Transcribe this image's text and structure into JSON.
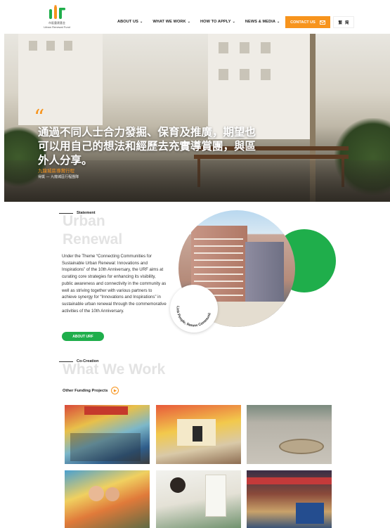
{
  "header": {
    "logo_cn": "市區重建基金",
    "logo_en": "Urban Renewal Fund",
    "nav": [
      "ABOUT US",
      "WHAT WE WORK",
      "HOW TO APPLY",
      "NEWS & MEDIA"
    ],
    "contact": "CONTACT US",
    "lang": [
      "繁",
      "简"
    ]
  },
  "hero": {
    "title": "通過不同人士合力發掘、保育及推廣，期望也可以用自己的想法和經歷去充實導賞團，與區外人分享。",
    "subtitle": "九龍城區導賞行程",
    "caption": "得獎 — 九龍城區行程團隊"
  },
  "statement": {
    "label": "Statement",
    "heading_line1": "Urban",
    "heading_line2": "Renewal",
    "text": "Under the Theme “Connecting Communities for Sustainable Urban Renewal: Innovations and Inspirations” of the 10th Anniversary, the URF aims at curating core strategies for enhancing its visibility, public awareness and connectivity in the community as well as striving together with various partners to achieve synergy for “Innovations and Inspirations” in sustainable urban renewal through the commemorative activities of the 10th Anniversary.",
    "button": "ABOUT URF",
    "circle_text": "Link People, Renew Community"
  },
  "work": {
    "label": "Co-Creation",
    "heading": "What We Work",
    "other_projects": "Other Funding Projects"
  },
  "colors": {
    "orange": "#f7941d",
    "green": "#1fae4b"
  }
}
